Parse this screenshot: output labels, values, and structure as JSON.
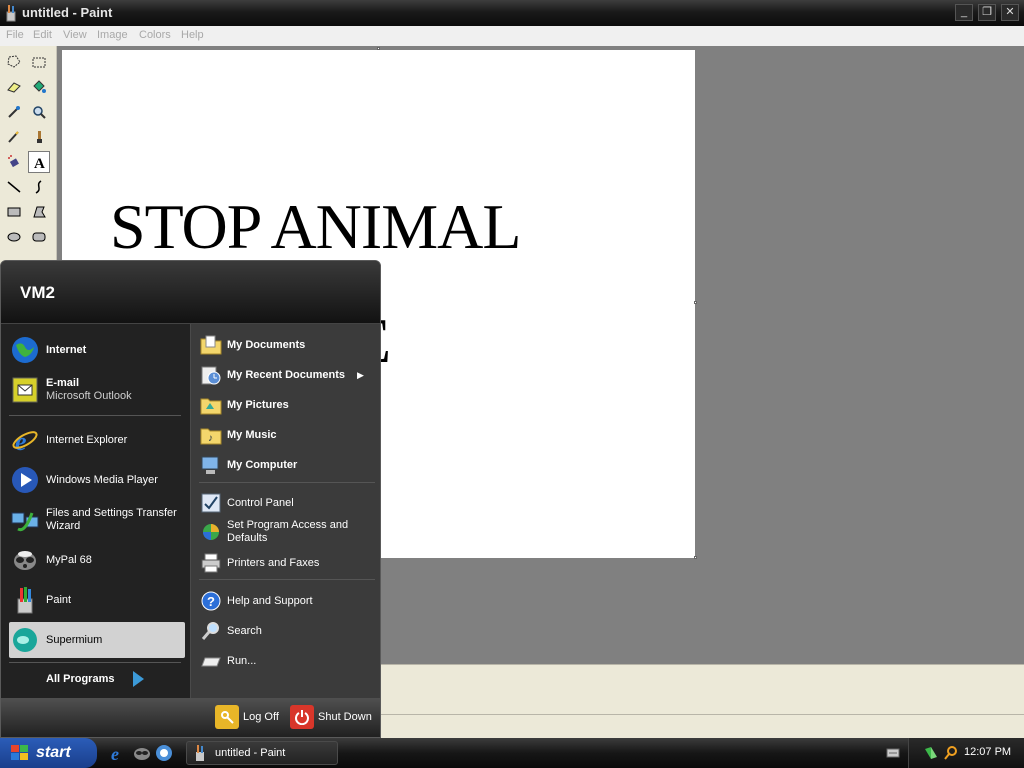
{
  "window": {
    "title": "untitled - Paint",
    "controls": {
      "minimize": "_",
      "maximize": "❐",
      "close": "✕"
    }
  },
  "menu": [
    "File",
    "Edit",
    "View",
    "Image",
    "Colors",
    "Help"
  ],
  "tools": [
    "free-form-select",
    "select",
    "eraser",
    "fill-with-color",
    "pick-color",
    "magnifier",
    "pencil",
    "brush",
    "airbrush",
    "text",
    "line",
    "curve",
    "rectangle",
    "polygon",
    "ellipse",
    "rounded-rectangle"
  ],
  "canvas": {
    "line1": "STOP ANIMAL",
    "line2": "E"
  },
  "start_menu": {
    "user": "VM2",
    "pinned": [
      {
        "title": "Internet",
        "sub": ""
      },
      {
        "title": "E-mail",
        "sub": "Microsoft Outlook"
      }
    ],
    "recent": [
      {
        "title": "Internet Explorer"
      },
      {
        "title": "Windows Media Player"
      },
      {
        "title": "Files and Settings Transfer",
        "title2": "Wizard"
      },
      {
        "title": "MyPal 68"
      },
      {
        "title": "Paint"
      },
      {
        "title": "Supermium"
      }
    ],
    "all_programs": "All Programs",
    "places": [
      "My Documents",
      "My Recent Documents",
      "My Pictures",
      "My Music",
      "My Computer"
    ],
    "settings": [
      "Control Panel",
      "Set Program Access and",
      "Defaults",
      "Printers and Faxes"
    ],
    "help": [
      "Help and Support",
      "Search",
      "Run..."
    ],
    "log_off": "Log Off",
    "shut_down": "Shut Down"
  },
  "taskbar": {
    "start": "start",
    "task": "untitled - Paint",
    "clock": "12:07 PM"
  }
}
